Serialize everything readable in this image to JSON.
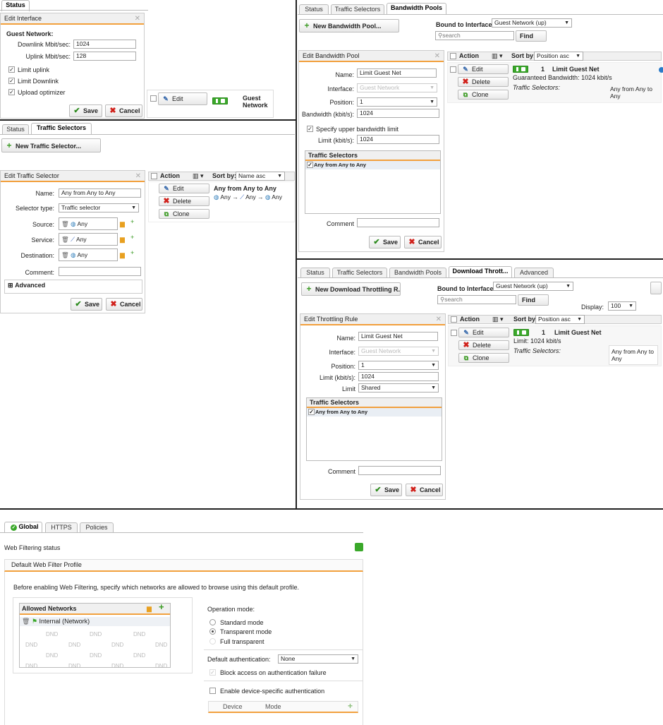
{
  "q1": {
    "tab_status": "Status",
    "panel_title": "Edit Interface",
    "section": "Guest Network:",
    "downlink_label": "Downlink Mbit/sec:",
    "downlink_value": "1024",
    "uplink_label": "Uplink Mbit/sec:",
    "uplink_value": "128",
    "cb_limit_uplink": "Limit uplink",
    "cb_limit_downlink": "Limit Downlink",
    "cb_upload_opt": "Upload optimizer",
    "save": "Save",
    "cancel": "Cancel",
    "edit": "Edit",
    "guest_line1": "Guest",
    "guest_line2": "Network"
  },
  "q2": {
    "tabs": [
      "Status",
      "Traffic Selectors",
      "Bandwidth Pools"
    ],
    "new_button": "New Bandwidth Pool...",
    "bound_label": "Bound to Interface:",
    "bound_value": "Guest Network (up)",
    "search_placeholder": "search",
    "find": "Find",
    "panel_title": "Edit Bandwidth Pool",
    "name_label": "Name:",
    "name_value": "Limit Guest Net",
    "interface_label": "Interface:",
    "interface_value": "Guest Network",
    "position_label": "Position:",
    "position_value": "1",
    "bandwidth_label": "Bandwidth (kbit/s):",
    "bandwidth_value": "1024",
    "upper_cb": "Specify upper bandwidth limit",
    "limit_label": "Limit (kbit/s):",
    "limit_value": "1024",
    "ts_header": "Traffic Selectors",
    "ts_row": "Any from Any to Any",
    "comment_label": "Comment",
    "save": "Save",
    "cancel": "Cancel",
    "action": "Action",
    "sortby": "Sort by:",
    "sort_value": "Position asc",
    "edit": "Edit",
    "delete": "Delete",
    "clone": "Clone",
    "item_num": "1",
    "item_name": "Limit Guest Net",
    "item_guaranteed": "Guaranteed Bandwidth: 1024 kbit/s",
    "item_ts_label": "Traffic Selectors:",
    "item_ts_value_1": "Any from Any to",
    "item_ts_value_2": "Any"
  },
  "q3": {
    "tabs": [
      "Status",
      "Traffic Selectors"
    ],
    "new_button": "New Traffic Selector...",
    "panel_title": "Edit Traffic Selector",
    "name_label": "Name:",
    "name_value": "Any from Any to Any",
    "type_label": "Selector type:",
    "type_value": "Traffic selector",
    "source_label": "Source:",
    "source_value": "Any",
    "service_label": "Service:",
    "service_value": "Any",
    "dest_label": "Destination:",
    "dest_value": "Any",
    "comment_label": "Comment:",
    "advanced": "Advanced",
    "save": "Save",
    "cancel": "Cancel",
    "action": "Action",
    "sortby": "Sort by:",
    "sort_value": "Name asc",
    "edit": "Edit",
    "delete": "Delete",
    "clone": "Clone",
    "item_name": "Any from Any to Any",
    "item_any_1": "Any",
    "item_any_2": "Any",
    "item_any_3": "Any"
  },
  "q4": {
    "tabs": [
      "Status",
      "Traffic Selectors",
      "Bandwidth Pools",
      "Download Thrott...",
      "Advanced"
    ],
    "new_button": "New Download Throttling R...",
    "bound_label": "Bound to Interface:",
    "bound_value": "Guest Network (up)",
    "search_placeholder": "search",
    "find": "Find",
    "display_label": "Display:",
    "display_value": "100",
    "panel_title": "Edit Throttling Rule",
    "name_label": "Name:",
    "name_value": "Limit Guest Net",
    "interface_label": "Interface:",
    "interface_value": "Guest Network",
    "position_label": "Position:",
    "position_value": "1",
    "limit_label": "Limit (kbit/s):",
    "limit_value": "1024",
    "limit2_label": "Limit",
    "limit2_value": "Shared",
    "ts_header": "Traffic Selectors",
    "ts_row": "Any from Any to Any",
    "comment_label": "Comment",
    "save": "Save",
    "cancel": "Cancel",
    "action": "Action",
    "sortby": "Sort by:",
    "sort_value": "Position asc",
    "edit": "Edit",
    "delete": "Delete",
    "clone": "Clone",
    "item_num": "1",
    "item_name": "Limit Guest Net",
    "item_limit": "Limit: 1024 kbit/s",
    "item_ts_label": "Traffic Selectors:",
    "item_ts_value_1": "Any from Any to",
    "item_ts_value_2": "Any"
  },
  "q5": {
    "tabs": [
      "Global",
      "HTTPS",
      "Policies"
    ],
    "wf_status": "Web Filtering status",
    "profile_header": "Default Web Filter Profile",
    "intro": "Before enabling Web Filtering, specify which networks are allowed to browse using this default profile.",
    "allowed_header": "Allowed Networks",
    "network_item": "Internal (Network)",
    "dnd": "DND",
    "op_mode_label": "Operation mode:",
    "mode_standard": "Standard mode",
    "mode_transparent": "Transparent mode",
    "mode_full": "Full transparent",
    "default_auth_label": "Default authentication:",
    "default_auth_value": "None",
    "block_access": "Block access on authentication failure",
    "device_auth": "Enable device-specific authentication",
    "col_device": "Device",
    "col_mode": "Mode"
  },
  "colors": {
    "accent": "#f2a03d",
    "green": "#3aa82a",
    "red": "#d0201a"
  }
}
